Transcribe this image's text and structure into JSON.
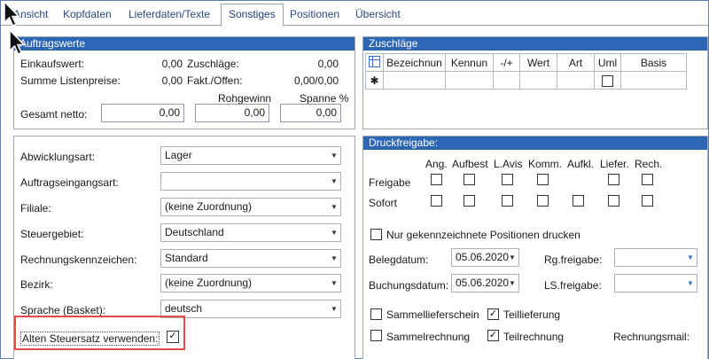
{
  "tabs": [
    {
      "label": "Ansicht"
    },
    {
      "label": "Kopfdaten"
    },
    {
      "label": "Lieferdaten/Texte"
    },
    {
      "label": "Sonstiges"
    },
    {
      "label": "Positionen"
    },
    {
      "label": "Übersicht"
    }
  ],
  "auftragswerte": {
    "title": "Auftragswerte",
    "einkaufswert_label": "Einkaufswert:",
    "einkaufswert_value": "0,00",
    "zuschlaege_label": "Zuschläge:",
    "zuschlaege_value": "0,00",
    "summe_listenpreise_label": "Summe Listenpreise:",
    "summe_listenpreise_value": "0,00",
    "fakt_offen_label": "Fakt./Offen:",
    "fakt_offen_value": "0,00/0,00",
    "rohgewinn_label": "Rohgewinn",
    "spanne_label": "Spanne %",
    "gesamt_netto_label": "Gesamt netto:",
    "gesamt_netto_value": "0,00",
    "rohgewinn_value": "0,00",
    "spanne_value": "0,00"
  },
  "zuschlaege": {
    "title": "Zuschläge",
    "columns": [
      "Bezeichnun",
      "Kennun",
      "-/+",
      "Wert",
      "Art",
      "Uml",
      "Basis"
    ],
    "new_row_marker": "✱"
  },
  "fields": [
    {
      "label": "Abwicklungsart:",
      "value": "Lager"
    },
    {
      "label": "Auftragseingangsart:",
      "value": ""
    },
    {
      "label": "Filiale:",
      "value": "(keine Zuordnung)"
    },
    {
      "label": "Steuergebiet:",
      "value": "Deutschland"
    },
    {
      "label": "Rechnungskennzeichen:",
      "value": "Standard"
    },
    {
      "label": "Bezirk:",
      "value": "(keine Zuordnung)"
    },
    {
      "label": "Sprache (Basket):",
      "value": "deutsch"
    }
  ],
  "alten_steuersatz": {
    "label": "Alten Steuersatz verwenden:",
    "checked": "✓"
  },
  "druckfreigabe": {
    "title": "Druckfreigabe:",
    "columns": [
      "Ang.",
      "Aufbest",
      "L.Avis",
      "Komm.",
      "Aufkl.",
      "Liefer.",
      "Rech."
    ],
    "row_freigabe": "Freigabe",
    "row_sofort": "Sofort",
    "nur_gekennzeichnete": "Nur gekennzeichnete Positionen drucken",
    "belegdatum_label": "Belegdatum:",
    "belegdatum_value": "05.06.2020",
    "buchungsdatum_label": "Buchungsdatum:",
    "buchungsdatum_value": "05.06.2020",
    "rg_freigabe_label": "Rg.freigabe:",
    "ls_freigabe_label": "LS.freigabe:",
    "sammellieferschein": "Sammellieferschein",
    "teillieferung": "Teillieferung",
    "sammelrechnung": "Sammelrechnung",
    "teilrechnung": "Teilrechnung",
    "rechnungsmail_label": "Rechnungsmail:",
    "check_mark": "✓"
  },
  "icons": {
    "dropdown": "▼",
    "grid_icon": "table-icon",
    "cursor": "mouse-pointer-icon"
  }
}
